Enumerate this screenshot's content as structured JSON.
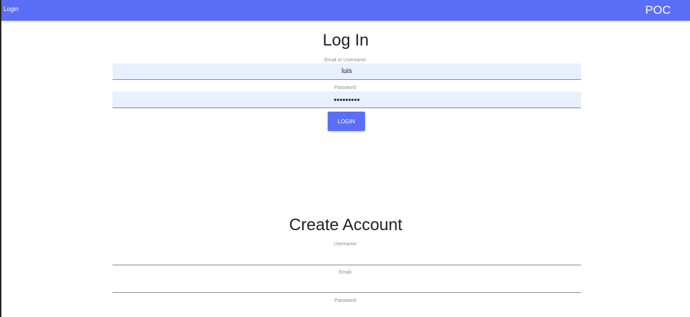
{
  "topbar": {
    "nav_link": "Login",
    "brand": "POC",
    "color": "#5a6ef8"
  },
  "login": {
    "title": "Log In",
    "username_label": "Email or Username:",
    "username_value": "luis",
    "password_label": "Password:",
    "password_value": "•••••••••",
    "button_label": "LOGIN"
  },
  "create_account": {
    "title": "Create Account",
    "username_label": "Username:",
    "email_label": "Email:",
    "password_label": "Password:"
  }
}
